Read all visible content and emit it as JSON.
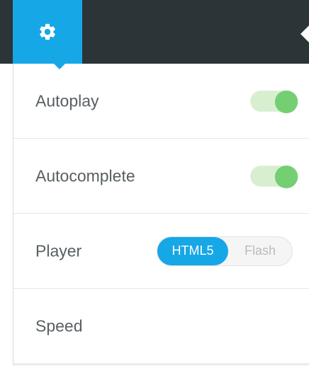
{
  "topbar": {
    "gear_icon": "gear-icon",
    "colors": {
      "tab": "#16a7e6",
      "bar": "#2b3437"
    }
  },
  "settings": {
    "items": [
      {
        "label": "Autoplay",
        "type": "toggle",
        "enabled": true
      },
      {
        "label": "Autocomplete",
        "type": "toggle",
        "enabled": true
      },
      {
        "label": "Player",
        "type": "segmented",
        "options": [
          "HTML5",
          "Flash"
        ],
        "selected": "HTML5"
      },
      {
        "label": "Speed",
        "type": "text"
      }
    ]
  }
}
